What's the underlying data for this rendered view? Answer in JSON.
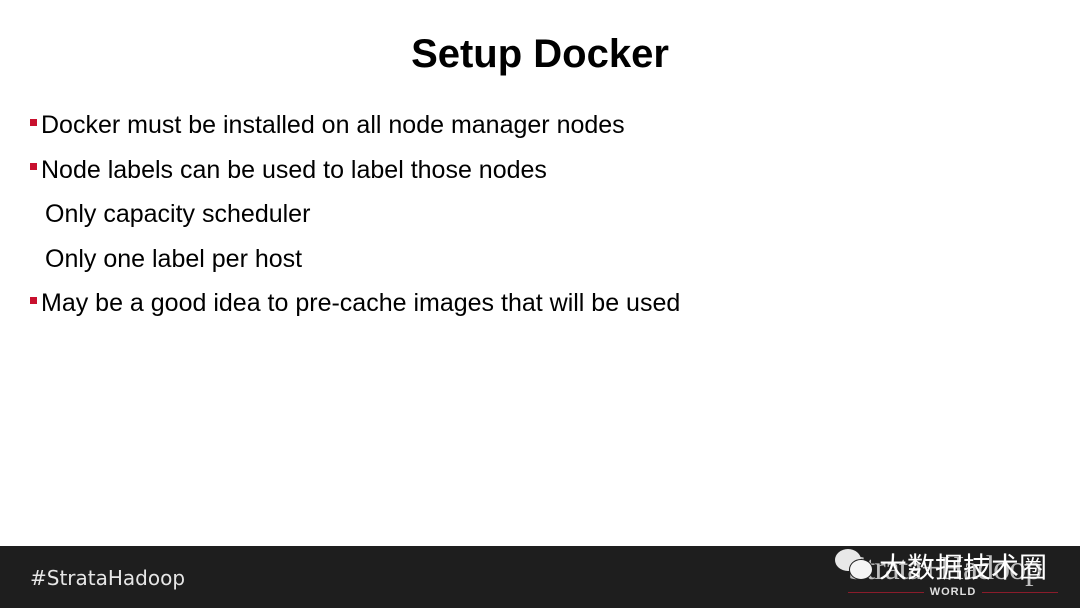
{
  "slide": {
    "title": "Setup Docker",
    "lines": [
      {
        "text": "Docker must be installed on all node manager nodes",
        "level": 1
      },
      {
        "text": "Node labels can be used to label those nodes",
        "level": 1
      },
      {
        "text": "Only capacity scheduler",
        "level": 2
      },
      {
        "text": "Only one label per host",
        "level": 2
      },
      {
        "text": "May be a good idea to pre-cache images that will be used",
        "level": 1
      }
    ],
    "bullet_color": "#c8102e"
  },
  "footer": {
    "hashtag": "#StrataHadoop",
    "logo_text": "Strata+Hadoop",
    "logo_sub": "WORLD",
    "watermark": "大数据技术圈"
  }
}
